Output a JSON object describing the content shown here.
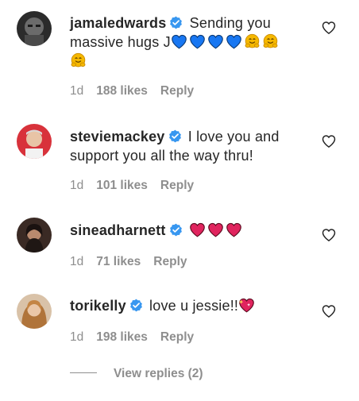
{
  "comments": [
    {
      "username": "jamaledwards",
      "text": "Sending you massive hugs J",
      "time": "1d",
      "likes": "188 likes",
      "reply": "Reply"
    },
    {
      "username": "steviemackey",
      "text": "I love you and support you all the way thru!",
      "time": "1d",
      "likes": "101 likes",
      "reply": "Reply"
    },
    {
      "username": "sineadharnett",
      "text": "",
      "time": "1d",
      "likes": "71 likes",
      "reply": "Reply"
    },
    {
      "username": "torikelly",
      "text": "love u jessie!!",
      "time": "1d",
      "likes": "198 likes",
      "reply": "Reply"
    }
  ],
  "view_replies": "View replies (2)",
  "icons": {
    "verified": "verified-badge-icon",
    "like": "heart-outline-icon",
    "blue_heart": "blue-heart-emoji",
    "hug": "hugging-face-emoji",
    "red_heart": "red-heart-emoji",
    "sparkling_heart": "sparkling-heart-emoji"
  },
  "colors": {
    "verified": "#3897f0",
    "muted": "#8e8e8e",
    "text": "#262626",
    "blue_heart": "#1877f2",
    "red_heart": "#e0245e",
    "hug": "#f5b800"
  }
}
